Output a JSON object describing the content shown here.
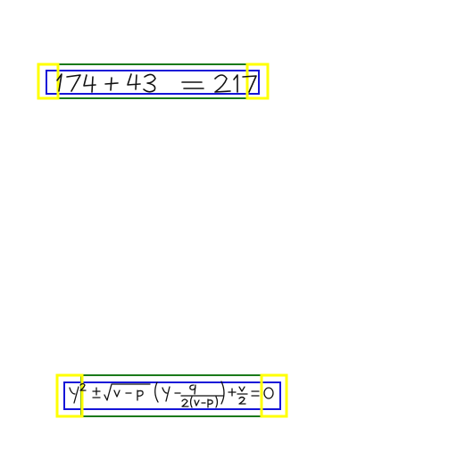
{
  "colors": {
    "background": "#ffffff",
    "green_box": "#1a7a1a",
    "blue_box": "#1515d8",
    "yellow_box": "#ffff00",
    "ink": "#111111"
  },
  "expressions": [
    {
      "text": "174 + 43 = 217",
      "style": "handwritten",
      "boxes": [
        "green",
        "blue",
        "yellow-left",
        "yellow-right"
      ]
    },
    {
      "text": "y² ± √(v − p) (y − q/(2(v − p))) + v/2 = 0",
      "style": "handwritten",
      "boxes": [
        "green",
        "blue",
        "yellow-left",
        "yellow-right"
      ]
    }
  ]
}
